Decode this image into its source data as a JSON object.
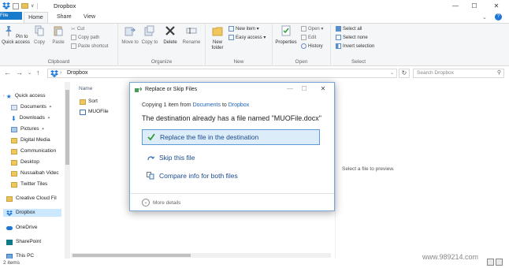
{
  "window": {
    "title": "Dropbox",
    "quick_access_chevron": "∨",
    "minimize": "—",
    "maximize": "☐",
    "close": "✕",
    "help": "?"
  },
  "tabs": [
    {
      "label": "File"
    },
    {
      "label": "Home"
    },
    {
      "label": "Share"
    },
    {
      "label": "View"
    }
  ],
  "ribbon": {
    "clipboard": {
      "label": "Clipboard",
      "pin": "Pin to Quick access",
      "copy": "Copy",
      "paste": "Paste",
      "cut": "Cut",
      "copy_path": "Copy path",
      "paste_shortcut": "Paste shortcut"
    },
    "organize": {
      "label": "Organize",
      "move_to": "Move to",
      "copy_to": "Copy to",
      "delete": "Delete",
      "rename": "Rename"
    },
    "new": {
      "label": "New",
      "new_folder": "New folder",
      "new_item": "New item",
      "easy_access": "Easy access"
    },
    "open": {
      "label": "Open",
      "properties": "Properties",
      "open": "Open",
      "edit": "Edit",
      "history": "History"
    },
    "select": {
      "label": "Select",
      "select_all": "Select all",
      "select_none": "Select none",
      "invert": "Invert selection"
    }
  },
  "address": {
    "path": "Dropbox",
    "search_placeholder": "Search Dropbox"
  },
  "sidebar": {
    "items": [
      {
        "label": "Quick access"
      },
      {
        "label": "Documents"
      },
      {
        "label": "Downloads"
      },
      {
        "label": "Pictures"
      },
      {
        "label": "Digital Media"
      },
      {
        "label": "Communication"
      },
      {
        "label": "Desktop"
      },
      {
        "label": "Nussaibah Videc"
      },
      {
        "label": "Twitter Tiles"
      },
      {
        "label": "Creative Cloud Fil"
      },
      {
        "label": "Dropbox"
      },
      {
        "label": "OneDrive"
      },
      {
        "label": "SharePoint"
      },
      {
        "label": "This PC"
      }
    ]
  },
  "files": {
    "column_name": "Name",
    "items": [
      {
        "name": "Sort"
      },
      {
        "name": "MUOFile"
      }
    ]
  },
  "preview_text": "Select a file to preview.",
  "status": {
    "items_count": "2 items"
  },
  "watermark": "www.989214.com",
  "dialog": {
    "title": "Replace or Skip Files",
    "copying_prefix": "Copying 1 item from",
    "copying_from": "Documents",
    "copying_to_word": "to",
    "copying_to": "Dropbox",
    "headline": "The destination already has a file named \"MUOFile.docx\"",
    "option_replace": "Replace the file in the destination",
    "option_skip": "Skip this file",
    "option_compare": "Compare info for both files",
    "more_details": "More details"
  },
  "colors": {
    "file_tab": "#1979ca",
    "link": "#1e63b9",
    "selection_bg": "#ddecf9",
    "selection_border": "#5c9bd8",
    "check_green": "#2e9a3a"
  }
}
